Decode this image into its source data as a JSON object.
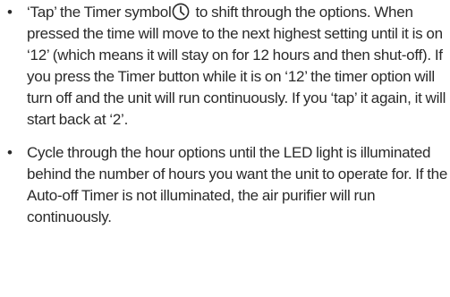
{
  "instructions": [
    {
      "bullet": "•",
      "text_before_icon": "‘Tap’ the Timer symbol",
      "icon": "timer-clock-icon",
      "text_after_icon": " to shift through the options. When pressed the time will move to the next highest setting until it is on ‘12’ (which means it will stay on for 12 hours and then shut-off). If you press the Timer button while it is on ‘12’ the timer option will turn off and the unit will run continuously. If you ‘tap’ it again, it will start back at ‘2’."
    },
    {
      "bullet": "•",
      "text": "Cycle through the hour options until the LED light is illuminated behind the number of hours you want the unit to operate for. If the Auto-off Timer is not illuminated, the air purifier will run continuously."
    }
  ],
  "colors": {
    "text": "#2a2a2a",
    "background": "#ffffff"
  }
}
